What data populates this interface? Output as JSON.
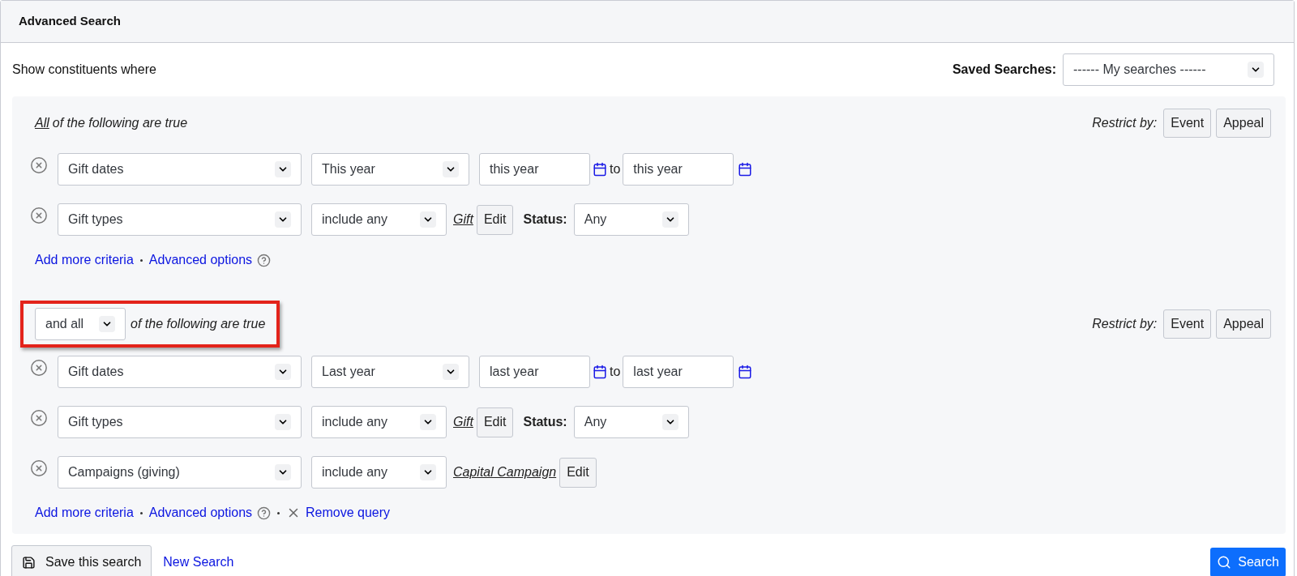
{
  "title": "Advanced Search",
  "intro": "Show constituents where",
  "saved_searches": {
    "label": "Saved Searches:",
    "value": "------ My searches ------"
  },
  "groups": [
    {
      "combinator": {
        "kind": "text",
        "lead": "All",
        "rest": "of the following are true"
      },
      "highlighted": false,
      "restrict": {
        "label": "Restrict by:",
        "buttons": [
          "Event",
          "Appeal"
        ]
      },
      "criteria": [
        {
          "kind": "date_range",
          "field": "Gift dates",
          "operator": "This year",
          "from": "this year",
          "to_label": "to",
          "to": "this year"
        },
        {
          "kind": "list",
          "field": "Gift types",
          "operator": "include any",
          "value": "Gift",
          "edit": "Edit",
          "status_label": "Status:",
          "status": "Any"
        }
      ],
      "links": [
        {
          "kind": "add",
          "text": "Add more criteria"
        },
        {
          "kind": "options",
          "text": "Advanced options"
        }
      ]
    },
    {
      "combinator": {
        "kind": "select",
        "lead": "and all",
        "rest": "of the following are true"
      },
      "highlighted": true,
      "restrict": {
        "label": "Restrict by:",
        "buttons": [
          "Event",
          "Appeal"
        ]
      },
      "criteria": [
        {
          "kind": "date_range",
          "field": "Gift dates",
          "operator": "Last year",
          "from": "last year",
          "to_label": "to",
          "to": "last year"
        },
        {
          "kind": "list",
          "field": "Gift types",
          "operator": "include any",
          "value": "Gift",
          "edit": "Edit",
          "status_label": "Status:",
          "status": "Any"
        },
        {
          "kind": "list",
          "field": "Campaigns (giving)",
          "operator": "include any",
          "value": "Capital Campaign",
          "edit": "Edit"
        }
      ],
      "links": [
        {
          "kind": "add",
          "text": "Add more criteria"
        },
        {
          "kind": "options",
          "text": "Advanced options"
        },
        {
          "kind": "remove",
          "text": "Remove query"
        }
      ]
    }
  ],
  "footer": {
    "save": "Save this search",
    "new": "New Search",
    "search": "Search"
  }
}
